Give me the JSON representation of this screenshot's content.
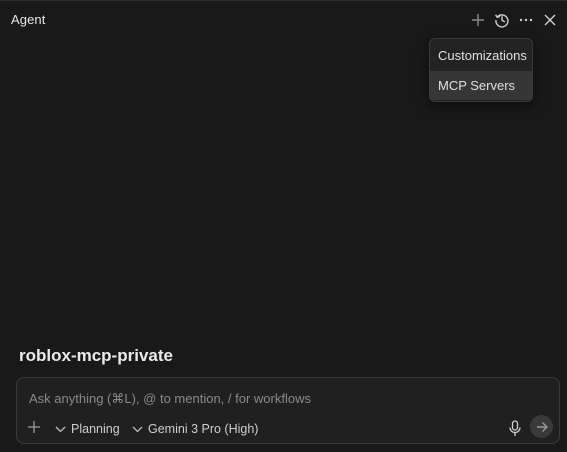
{
  "header": {
    "title": "Agent",
    "icons": {
      "new": "plus-icon",
      "history": "history-icon",
      "more": "more-icon",
      "close": "close-icon"
    }
  },
  "menu": {
    "items": [
      {
        "label": "Customizations"
      },
      {
        "label": "MCP Servers"
      }
    ]
  },
  "workspace": {
    "name": "roblox-mcp-private"
  },
  "composer": {
    "placeholder": "Ask anything (⌘L), @ to mention, / for workflows",
    "value": "",
    "mode_label": "Planning",
    "model_label": "Gemini 3 Pro (High)",
    "icons": {
      "add": "plus-icon",
      "mode_chevron": "chevron-down-icon",
      "model_chevron": "chevron-down-icon",
      "mic": "microphone-icon",
      "send": "arrow-right-icon"
    }
  },
  "colors": {
    "background": "#191919",
    "menu_background": "#232323",
    "menu_highlight": "#363636",
    "composer_background": "#202020",
    "border": "#3a3a3a"
  }
}
